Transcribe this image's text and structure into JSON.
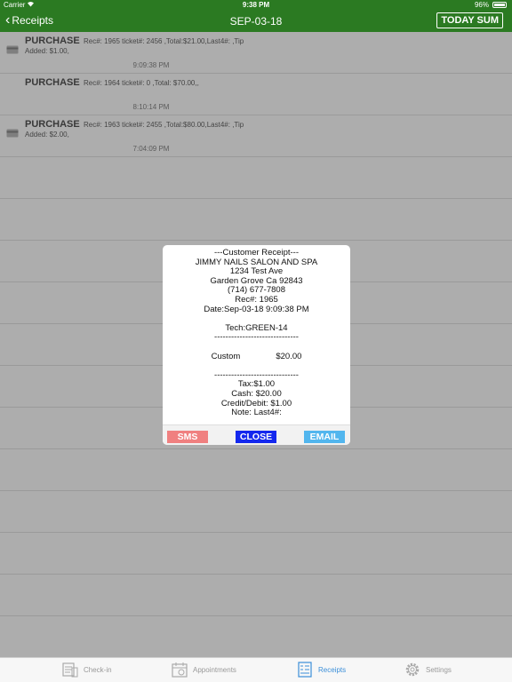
{
  "status": {
    "carrier": "Carrier",
    "time": "9:38 PM",
    "battery": "96%"
  },
  "nav": {
    "back_label": "Receipts",
    "title": "SEP-03-18",
    "today_label": "TODAY SUM"
  },
  "receipts": [
    {
      "type": "PURCHASE",
      "details": "Rec#: 1965 ticket#: 2456 ,Total:$21.00,Last4#: ,Tip Added: $1.00,",
      "time": "9:09:38 PM",
      "icon": "credit-card-icon"
    },
    {
      "type": "PURCHASE",
      "details": "Rec#: 1964 ticket#: 0 ,Total: $70.00,,",
      "time": "8:10:14 PM",
      "icon": ""
    },
    {
      "type": "PURCHASE",
      "details": "Rec#: 1963 ticket#: 2455 ,Total:$80.00,Last4#: ,Tip Added: $2.00,",
      "time": "7:04:09 PM",
      "icon": "credit-card-icon"
    }
  ],
  "popup": {
    "header": "---Customer Receipt---",
    "salon": "JIMMY NAILS SALON AND SPA",
    "address1": "1234 Test Ave",
    "address2": "Garden Grove Ca 92843",
    "phone": "(714) 677-7808",
    "rec": "Rec#: 1965",
    "date": "Date:Sep-03-18 9:09:38 PM",
    "tech": "Tech:GREEN-14",
    "divider": "------------------------------",
    "item_name": "Custom",
    "item_price": "$20.00",
    "divider2": "------------------------------",
    "tax": "Tax:$1.00",
    "cash": "Cash: $20.00",
    "credit": "Credit/Debit: $1.00",
    "note": "Note: Last4#:",
    "sms_label": "SMS",
    "close_label": "CLOSE",
    "email_label": "EMAIL"
  },
  "tabs": [
    {
      "label": "Check-in",
      "icon": "check-in-icon",
      "active": false
    },
    {
      "label": "Appointments",
      "icon": "calendar-icon",
      "active": false
    },
    {
      "label": "Receipts",
      "icon": "receipt-icon",
      "active": true
    },
    {
      "label": "Settings",
      "icon": "gear-icon",
      "active": false
    }
  ],
  "colors": {
    "nav_green": "#2b7a22",
    "sms": "#f08080",
    "close": "#1428ee",
    "email": "#52b6ee",
    "tab_active": "#3b8fd9"
  }
}
